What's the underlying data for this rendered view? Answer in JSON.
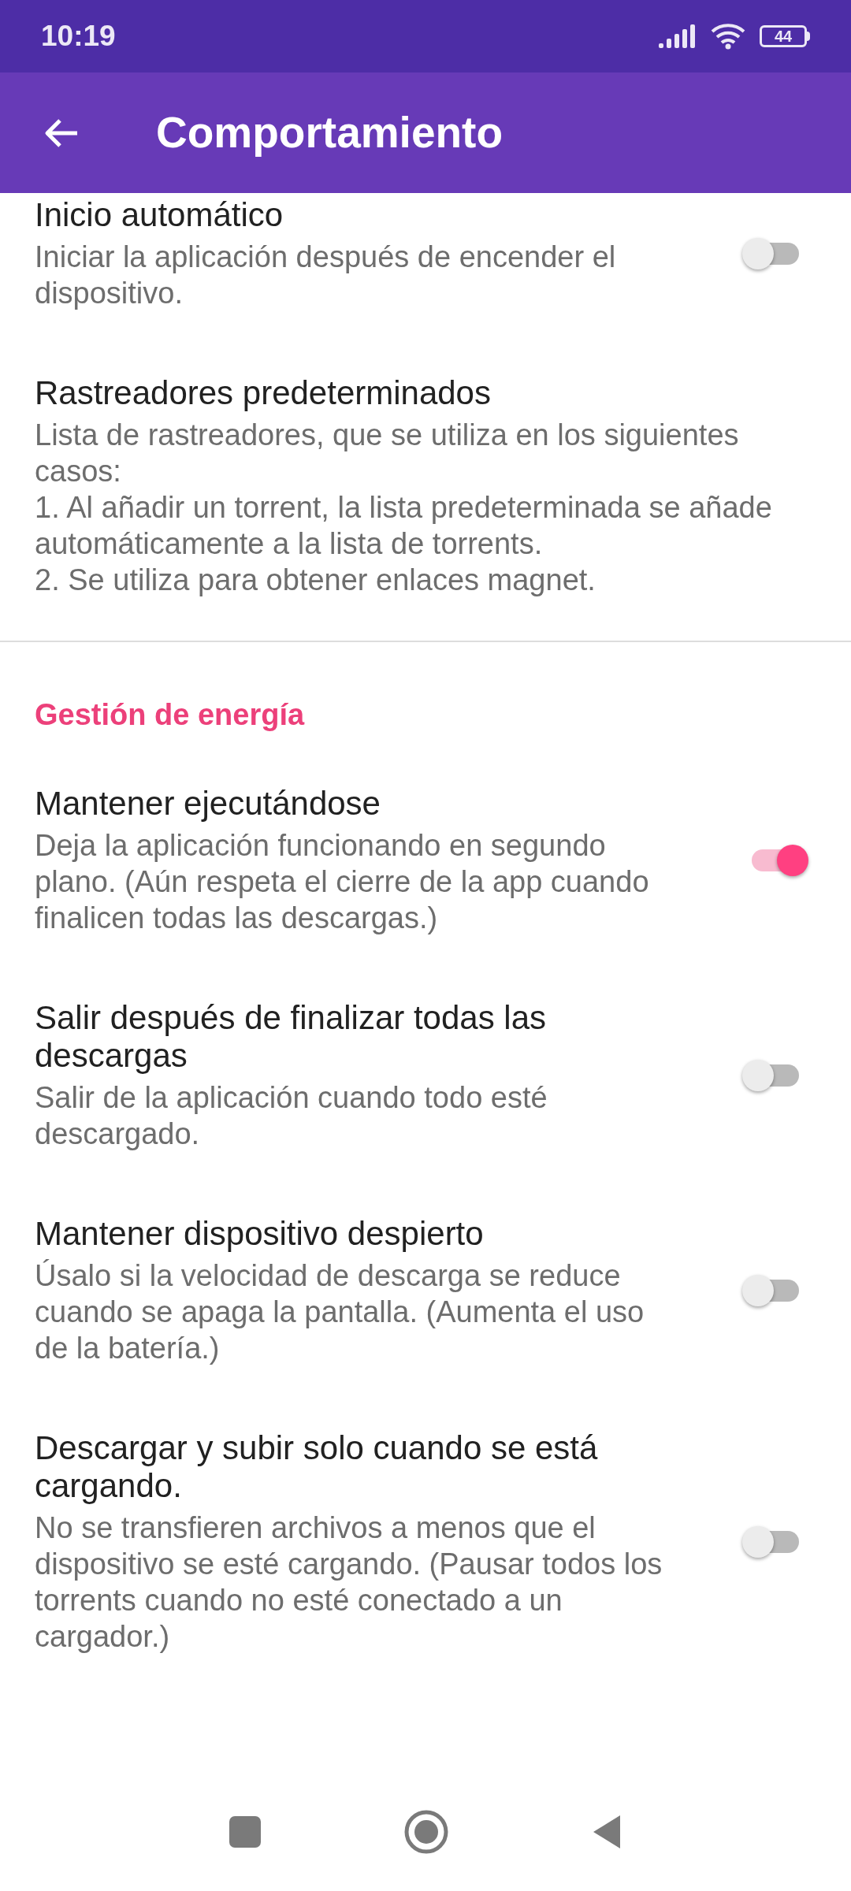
{
  "status_bar": {
    "time": "10:19",
    "battery": "44"
  },
  "app_bar": {
    "title": "Comportamiento"
  },
  "settings": [
    {
      "kind": "switch",
      "title": "Inicio automático",
      "summary": "Iniciar la aplicación después de encender el dispositivo.",
      "on": false
    },
    {
      "kind": "plain",
      "title": "Rastreadores predeterminados",
      "summary": "Lista de rastreadores, que se utiliza en los siguientes casos:\n1. Al añadir un torrent, la lista predeterminada se añade automáticamente a la lista de torrents.\n2. Se utiliza para obtener enlaces magnet."
    },
    {
      "kind": "category",
      "title": "Gestión de energía"
    },
    {
      "kind": "switch",
      "title": "Mantener ejecutándose",
      "summary": "Deja la aplicación funcionando en segundo plano. (Aún respeta el cierre de la app cuando finalicen todas las descargas.)",
      "on": true
    },
    {
      "kind": "switch",
      "title": "Salir después de finalizar todas las descargas",
      "summary": "Salir de la aplicación cuando todo esté descargado.",
      "on": false
    },
    {
      "kind": "switch",
      "title": "Mantener dispositivo despierto",
      "summary": "Úsalo si la velocidad de descarga se reduce cuando se apaga la pantalla. (Aumenta el uso de la batería.)",
      "on": false
    },
    {
      "kind": "switch",
      "title": "Descargar y subir solo cuando se está cargando.",
      "summary": "No se transfieren archivos a menos que el dispositivo se esté cargando. (Pausar todos los torrents cuando no esté conectado a un cargador.)",
      "on": false
    }
  ]
}
